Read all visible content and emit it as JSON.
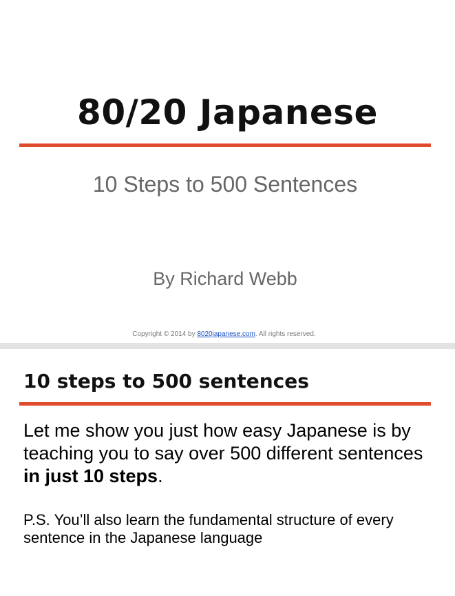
{
  "cover": {
    "title": "80/20 Japanese",
    "subtitle": "10 Steps to 500 Sentences",
    "author": "By Richard Webb",
    "copyright_prefix": "Copyright © 2014 by ",
    "copyright_link": "8020japanese.com",
    "copyright_suffix": ". All rights reserved."
  },
  "content": {
    "heading": "10 steps to 500 sentences",
    "intro_text": "Let me show you just how easy Japanese is by teaching you to say over 500 different sentences ",
    "intro_bold": "in just 10 steps",
    "intro_end": ".",
    "ps": "P.S. You’ll also learn the fundamental structure of every sentence in the Japanese language"
  },
  "colors": {
    "accent_rule": "#e04b2e",
    "subtitle_gray": "#666666",
    "link_blue": "#1a4fc4"
  }
}
